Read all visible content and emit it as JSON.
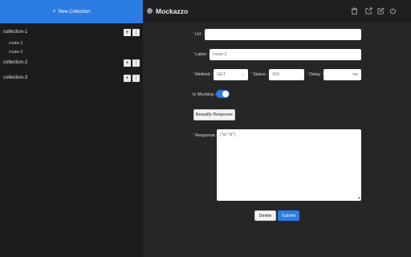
{
  "sidebar": {
    "new_collection_label": "New Collection",
    "collections": [
      {
        "name": "collection-1",
        "routes": [
          "route-1",
          "route-2"
        ]
      },
      {
        "name": "collection-2",
        "routes": []
      },
      {
        "name": "collection-3",
        "routes": []
      }
    ],
    "add_symbol": "+",
    "more_symbol": "⋮"
  },
  "header": {
    "title": "Mockazzo",
    "icons": [
      "trash-icon",
      "export-icon",
      "edit-icon",
      "power-icon"
    ]
  },
  "form": {
    "url_label": "Url :",
    "url_value": "",
    "label_label": "Label :",
    "label_value": "route-2",
    "method_label": "Method :",
    "method_value": "GET",
    "status_label": "Status :",
    "status_value": "200",
    "delay_label": "Delay :",
    "delay_value": "",
    "delay_unit": "ms",
    "mocking_label": "Is Mocking :",
    "mocking_on": true,
    "beautify_label": "Beautify Response",
    "response_label": "Response :",
    "response_value": "{\"a\":\"b\"}",
    "delete_label": "Delete",
    "submit_label": "Submit"
  },
  "colors": {
    "accent": "#2b7ce3",
    "sidebar_bg": "#1c1c1e",
    "main_bg": "#262628",
    "required": "#e33355"
  }
}
